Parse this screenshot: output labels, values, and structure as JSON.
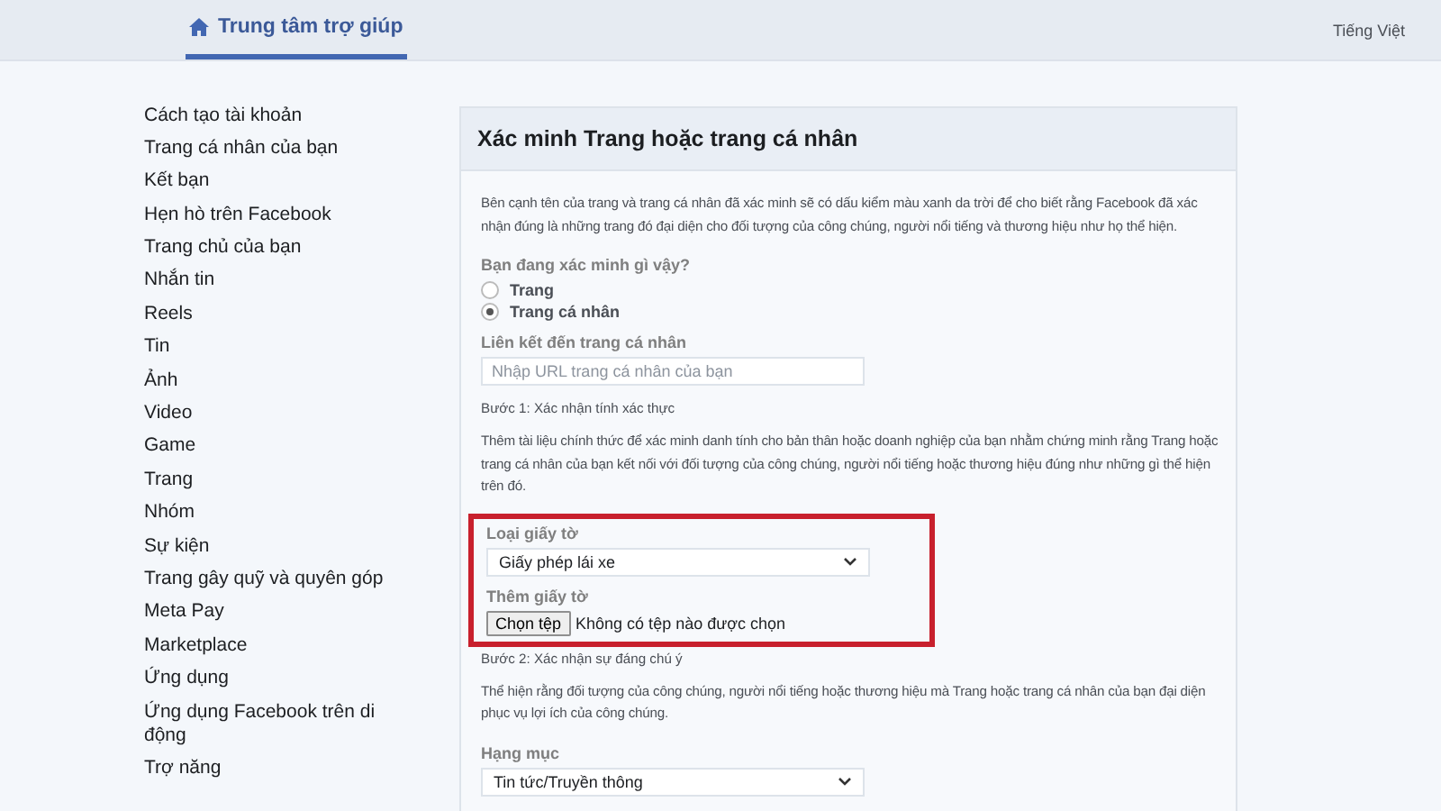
{
  "header": {
    "title": "Trung tâm trợ giúp",
    "language": "Tiếng Việt"
  },
  "sidebar": {
    "items": [
      "Cách tạo tài khoản",
      "Trang cá nhân của bạn",
      "Kết bạn",
      "Hẹn hò trên Facebook",
      "Trang chủ của bạn",
      "Nhắn tin",
      "Reels",
      "Tin",
      "Ảnh",
      "Video",
      "Game",
      "Trang",
      "Nhóm",
      "Sự kiện",
      "Trang gây quỹ và quyên góp",
      "Meta Pay",
      "Marketplace",
      "Ứng dụng",
      "Ứng dụng Facebook trên di động",
      "Trợ năng"
    ]
  },
  "card": {
    "title": "Xác minh Trang hoặc trang cá nhân",
    "intro": "Bên cạnh tên của trang và trang cá nhân đã xác minh sẽ có dấu kiểm màu xanh da trời để cho biết rằng Facebook đã xác nhận đúng là những trang đó đại diện cho đối tượng của công chúng, người nổi tiếng và thương hiệu như họ thể hiện.",
    "question": "Bạn đang xác minh gì vậy?",
    "options": [
      {
        "label": "Trang",
        "selected": false
      },
      {
        "label": "Trang cá nhân",
        "selected": true
      }
    ],
    "link_label": "Liên kết đến trang cá nhân",
    "link_field": {
      "placeholder": "Nhập URL trang cá nhân của bạn"
    },
    "step1": "Bước 1: Xác nhận tính xác thực",
    "step1_text": "Thêm tài liệu chính thức để xác minh danh tính cho bản thân hoặc doanh nghiệp của bạn nhằm chứng minh rằng Trang hoặc trang cá nhân của bạn kết nối với đối tượng của công chúng, người nổi tiếng hoặc thương hiệu đúng như những gì thể hiện trên đó.",
    "document": {
      "highlighted": true,
      "type_label": "Loại giấy tờ",
      "type_value": "Giấy phép lái xe",
      "add_label": "Thêm giấy tờ",
      "file_button": "Chọn tệp",
      "file_status": "Không có tệp nào được chọn"
    },
    "step2": "Bước 2: Xác nhận sự đáng chú ý",
    "step2_text": "Thể hiện rằng đối tượng của công chúng, người nổi tiếng hoặc thương hiệu mà Trang hoặc trang cá nhân của bạn đại diện phục vụ lợi ích của công chúng.",
    "category_label": "Hạng mục",
    "category_value": "Tin tức/Truyền thông"
  }
}
